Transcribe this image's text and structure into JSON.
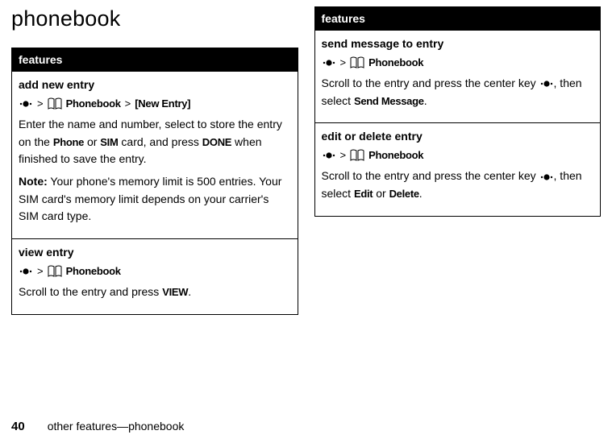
{
  "page_title": "phonebook",
  "footer": {
    "page_number": "40",
    "section": "other features—phonebook"
  },
  "labels": {
    "greater_than": ">",
    "phonebook": "Phonebook",
    "new_entry": "[New Entry]",
    "note": "Note:",
    "phone": "Phone",
    "sim": "SIM",
    "done": "DONE",
    "view": "VIEW",
    "send_message": "Send Message",
    "edit": "Edit",
    "delete": "Delete"
  },
  "left_table": {
    "header": "features",
    "rows": {
      "add_new_entry": {
        "title": "add new entry",
        "body1_a": "Enter the name and number, select to store the entry on the ",
        "body1_b": " or ",
        "body1_c": " card, and press ",
        "body1_d": " when finished to save the entry.",
        "note_body": " Your phone's memory limit is 500 entries. Your SIM card's memory limit depends on your carrier's SIM card type."
      },
      "view_entry": {
        "title": "view entry",
        "body_a": "Scroll to the entry and press ",
        "body_b": "."
      }
    }
  },
  "right_table": {
    "header": "features",
    "rows": {
      "send_message": {
        "title": "send message to entry",
        "body_a": "Scroll to the entry and press the center key ",
        "body_b": ", then select ",
        "body_c": "."
      },
      "edit_delete": {
        "title": "edit or delete entry",
        "body_a": "Scroll to the entry and press the center key ",
        "body_b": ", then select ",
        "body_c": " or ",
        "body_d": "."
      }
    }
  }
}
